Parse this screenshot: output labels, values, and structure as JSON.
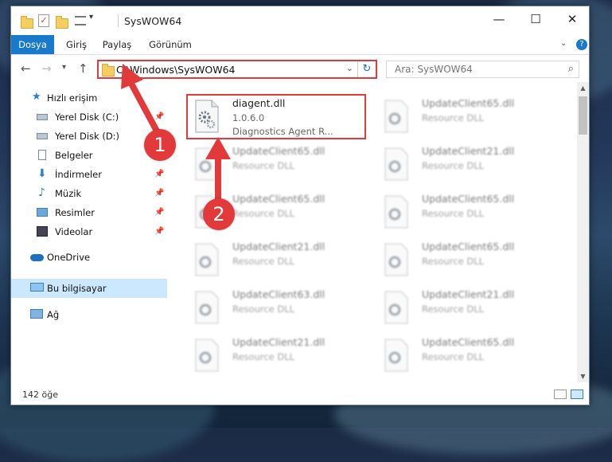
{
  "window": {
    "title": "SysWOW64",
    "controls": {
      "minimize": "—",
      "maximize": "☐",
      "close": "✕"
    }
  },
  "ribbon": {
    "tabs": [
      "Dosya",
      "Giriş",
      "Paylaş",
      "Görünüm"
    ],
    "accent": "#1979ca"
  },
  "address": {
    "path": "C:\\Windows\\SysWOW64",
    "refresh_icon": "refresh-icon"
  },
  "search": {
    "placeholder": "Ara: SysWOW64"
  },
  "nav_pane": {
    "items": [
      {
        "label": "Hızlı erişim",
        "icon": "star-icon"
      },
      {
        "label": "Yerel Disk (C:)",
        "icon": "drive-icon",
        "pinned": true
      },
      {
        "label": "Yerel Disk (D:)",
        "icon": "drive-icon"
      },
      {
        "label": "Belgeler",
        "icon": "document-icon"
      },
      {
        "label": "İndirmeler",
        "icon": "download-icon",
        "pinned": true
      },
      {
        "label": "Müzik",
        "icon": "music-icon",
        "pinned": true
      },
      {
        "label": "Resimler",
        "icon": "picture-icon",
        "pinned": true
      },
      {
        "label": "Videolar",
        "icon": "video-icon",
        "pinned": true
      },
      {
        "label": "OneDrive",
        "icon": "cloud-icon"
      },
      {
        "label": "Bu bilgisayar",
        "icon": "computer-icon",
        "selected": true
      },
      {
        "label": "Ağ",
        "icon": "network-icon"
      }
    ]
  },
  "files": {
    "highlighted": {
      "name": "diagent.dll",
      "version": "1.0.6.0",
      "description": "Diagnostics Agent R..."
    },
    "others": [
      {
        "name": "UpdateClient65.dll",
        "type": "Resource DLL"
      },
      {
        "name": "UpdateClient65.dll",
        "type": "Resource DLL"
      },
      {
        "name": "UpdateClient21.dll",
        "type": "Resource DLL"
      },
      {
        "name": "UpdateClient65.dll",
        "type": "Resource DLL"
      },
      {
        "name": "UpdateClient65.dll",
        "type": "Resource DLL"
      },
      {
        "name": "UpdateClient21.dll",
        "type": "Resource DLL"
      },
      {
        "name": "UpdateClient65.dll",
        "type": "Resource DLL"
      },
      {
        "name": "UpdateClient63.dll",
        "type": "Resource DLL"
      },
      {
        "name": "UpdateClient21.dll",
        "type": "Resource DLL"
      },
      {
        "name": "UpdateClient21.dll",
        "type": "Resource DLL"
      },
      {
        "name": "UpdateClient65.dll",
        "type": "Resource DLL"
      }
    ]
  },
  "status": {
    "item_count": "142 öğe"
  },
  "annotations": {
    "step1": "1",
    "step2": "2",
    "color": "#e23a3a"
  }
}
